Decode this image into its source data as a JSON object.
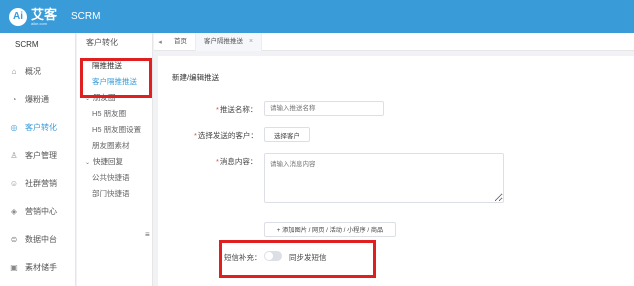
{
  "topbar": {
    "logo_mark": "Ai",
    "logo_name": "艾客",
    "logo_url": "aike.com",
    "product": "SCRM"
  },
  "sidebar": {
    "title": "SCRM",
    "items": [
      {
        "label": "概况",
        "icon": "home-icon"
      },
      {
        "label": "爆粉通",
        "icon": "flame-icon"
      },
      {
        "label": "客户转化",
        "icon": "target-icon",
        "active": true
      },
      {
        "label": "客户管理",
        "icon": "user-icon"
      },
      {
        "label": "社群营销",
        "icon": "group-icon"
      },
      {
        "label": "营销中心",
        "icon": "megaphone-icon"
      },
      {
        "label": "数据中台",
        "icon": "database-icon"
      },
      {
        "label": "素材储手",
        "icon": "folder-icon"
      }
    ]
  },
  "submenu": {
    "title": "客户转化",
    "items": [
      {
        "label": "隔推推送",
        "kind": "item",
        "style": "strong"
      },
      {
        "label": "客户隔推推送",
        "kind": "item",
        "style": "active"
      },
      {
        "label": "朋友圈",
        "kind": "group"
      },
      {
        "label": "H5 朋友圈",
        "kind": "item"
      },
      {
        "label": "H5 朋友圈设置",
        "kind": "item"
      },
      {
        "label": "朋友圈素材",
        "kind": "item"
      },
      {
        "label": "快捷回复",
        "kind": "group"
      },
      {
        "label": "公共快捷语",
        "kind": "item"
      },
      {
        "label": "部门快捷语",
        "kind": "item"
      }
    ]
  },
  "tabs": {
    "prev": "◂",
    "next": "▸",
    "list": [
      {
        "label": "首页",
        "closable": false
      },
      {
        "label": "客户隔推推送",
        "closable": true,
        "active": true
      }
    ],
    "close_symbol": "×"
  },
  "form": {
    "title": "新建/编辑推送",
    "name_label": "推送名称：",
    "name_placeholder": "请输入推送名称",
    "customers_label": "选择发送的客户：",
    "customers_button": "选择客户",
    "content_label": "消息内容：",
    "content_placeholder": "请输入消息内容",
    "attach_button": "+ 添加图片 / 网页 / 活动 / 小程序 / 商品",
    "sms_label": "短信补充：",
    "sms_toggle_on": false,
    "sms_toggle_text": "同步发短信"
  },
  "colors": {
    "brand": "#3a9bd9",
    "highlight": "#e02020",
    "required": "#e04b4b"
  }
}
